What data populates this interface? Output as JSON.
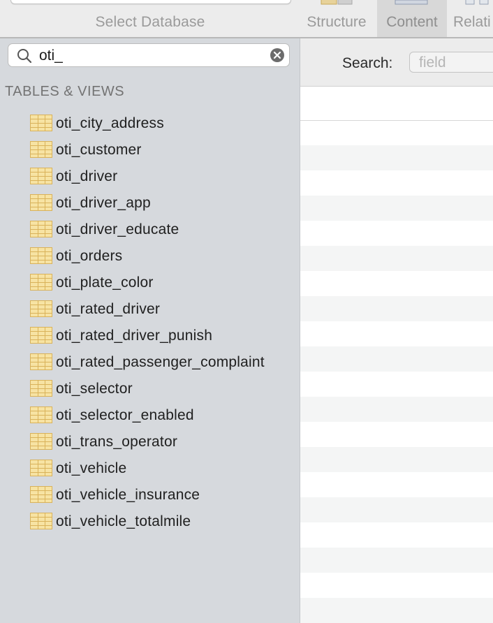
{
  "toolbar": {
    "select_database_label": "Select Database",
    "tabs": [
      {
        "label": "Structure",
        "icon": "structure-icon"
      },
      {
        "label": "Content",
        "icon": "content-icon",
        "selected": true
      },
      {
        "label": "Relati",
        "icon": "relations-icon"
      }
    ]
  },
  "sidebar": {
    "filter": {
      "value": "oti_",
      "search_icon": "search-icon",
      "clear_icon": "clear-icon"
    },
    "section_header": "TABLES & VIEWS",
    "tables": [
      "oti_city_address",
      "oti_customer",
      "oti_driver",
      "oti_driver_app",
      "oti_driver_educate",
      "oti_orders",
      "oti_plate_color",
      "oti_rated_driver",
      "oti_rated_driver_punish",
      "oti_rated_passenger_complaint",
      "oti_selector",
      "oti_selector_enabled",
      "oti_trans_operator",
      "oti_vehicle",
      "oti_vehicle_insurance",
      "oti_vehicle_totalmile"
    ]
  },
  "content": {
    "search_label": "Search:",
    "field_placeholder": "field"
  },
  "colors": {
    "sidebar_bg": "#d6d9dd",
    "toolbar_bg": "#ececec",
    "table_icon_fill": "#f7e3a3",
    "table_icon_stroke": "#d9b25a",
    "zebra_row": "#f4f5f5"
  }
}
